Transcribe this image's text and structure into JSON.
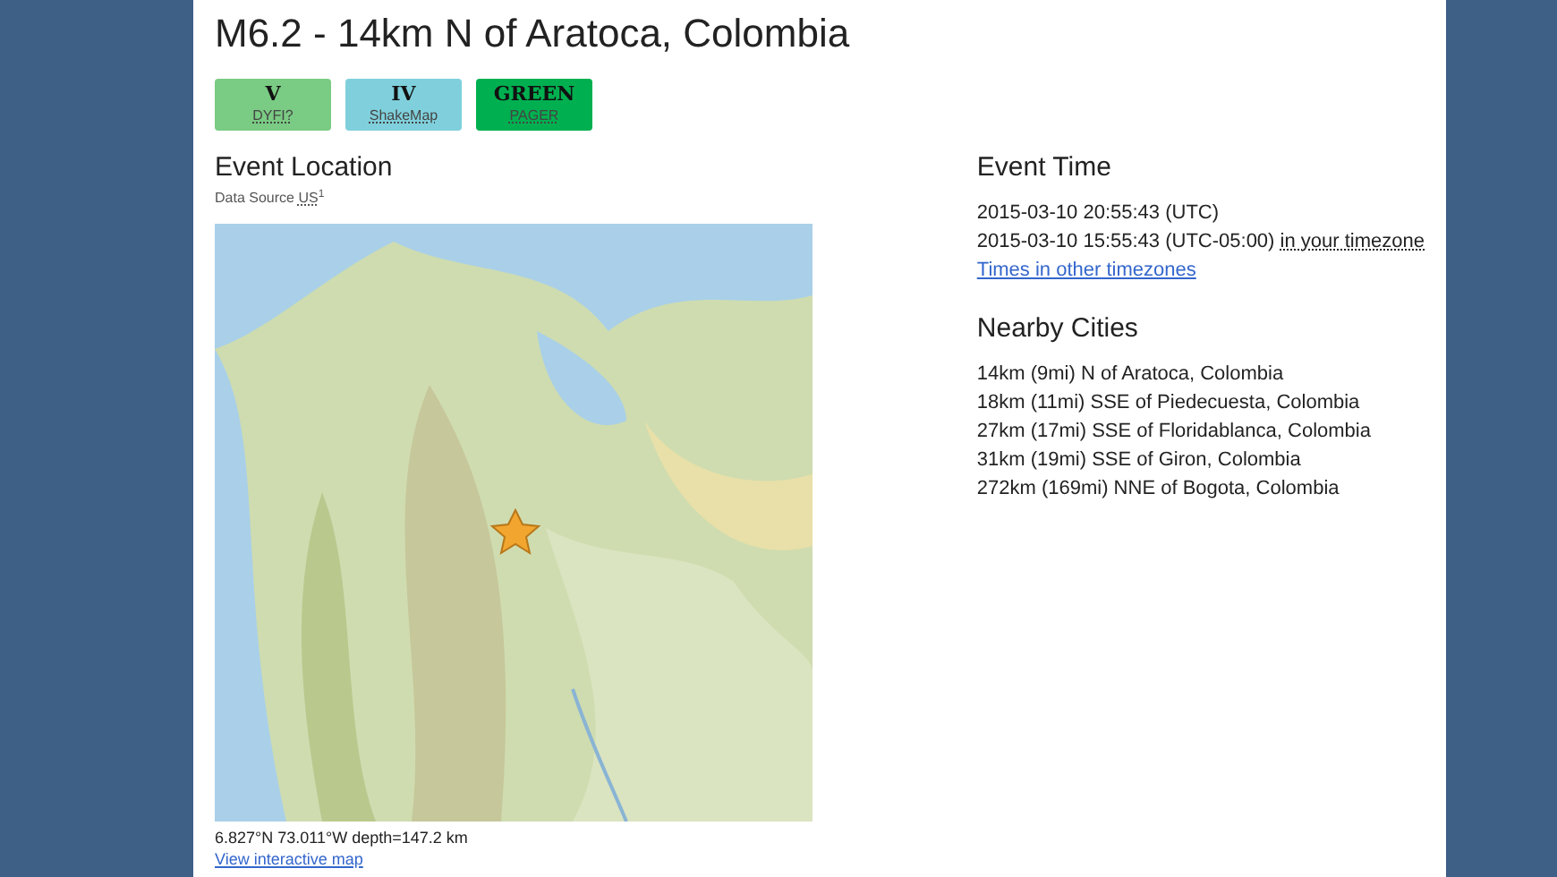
{
  "title": "M6.2 - 14km N of Aratoca, Colombia",
  "badges": [
    {
      "value": "V",
      "label": "DYFI?",
      "color": "#7acb83"
    },
    {
      "value": "IV",
      "label": "ShakeMap",
      "color": "#7fd0dc"
    },
    {
      "value": "GREEN",
      "label": "PAGER",
      "color": "#00b050"
    }
  ],
  "location": {
    "heading": "Event Location",
    "source_label": "Data Source",
    "source": "US",
    "source_mark": "1",
    "coordinates": "6.827°N 73.011°W depth=147.2 km",
    "link": "View interactive map"
  },
  "time": {
    "heading": "Event Time",
    "utc": "2015-03-10 20:55:43 (UTC)",
    "local": "2015-03-10 15:55:43 (UTC-05:00)",
    "local_note": "in your timezone",
    "link": "Times in other timezones"
  },
  "nearby": {
    "heading": "Nearby Cities",
    "cities": [
      "14km (9mi) N of Aratoca, Colombia",
      "18km (11mi) SSE of Piedecuesta, Colombia",
      "27km (17mi) SSE of Floridablanca, Colombia",
      "31km (19mi) SSE of Giron, Colombia",
      "272km (169mi) NNE of Bogota, Colombia"
    ]
  }
}
